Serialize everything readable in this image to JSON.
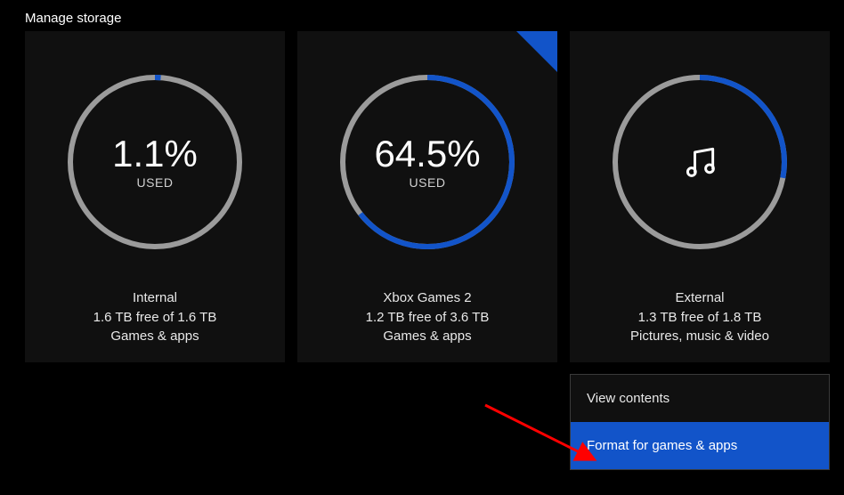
{
  "title": "Manage storage",
  "accent": "#1254c9",
  "cards": [
    {
      "id": "internal",
      "pct_label": "1.1%",
      "pct_value": 1.1,
      "used_label": "USED",
      "name": "Internal",
      "free_line": "1.6 TB free of 1.6 TB",
      "content_line": "Games & apps",
      "flag": false,
      "show_pct": true,
      "icon": null
    },
    {
      "id": "xbox-games-2",
      "pct_label": "64.5%",
      "pct_value": 64.5,
      "used_label": "USED",
      "name": "Xbox Games 2",
      "free_line": "1.2 TB free of 3.6 TB",
      "content_line": "Games & apps",
      "flag": true,
      "show_pct": true,
      "icon": null
    },
    {
      "id": "external",
      "pct_label": "",
      "pct_value": 28,
      "used_label": "",
      "name": "External",
      "free_line": "1.3 TB free of 1.8 TB",
      "content_line": "Pictures, music & video",
      "flag": false,
      "show_pct": false,
      "icon": "music-icon"
    }
  ],
  "context_menu": {
    "items": [
      {
        "label": "View contents",
        "selected": false
      },
      {
        "label": "Format for games & apps",
        "selected": true
      }
    ]
  }
}
